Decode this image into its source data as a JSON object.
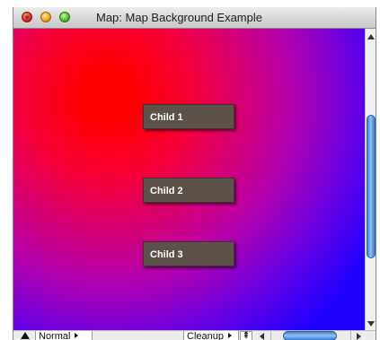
{
  "window": {
    "title": "Map: Map Background Example"
  },
  "canvas": {
    "nodes": [
      {
        "label": "Child 1"
      },
      {
        "label": "Child 2"
      },
      {
        "label": "Child 3"
      }
    ]
  },
  "bottom_bar": {
    "view_mode": "Normal",
    "layout_action": "Cleanup",
    "zoom_icon": "fit-icon"
  },
  "colors": {
    "gradient_center": "#ff0000",
    "gradient_edge": "#2000ff",
    "node_fill": "#5d5249",
    "scroll_thumb": "#5a9de8"
  }
}
